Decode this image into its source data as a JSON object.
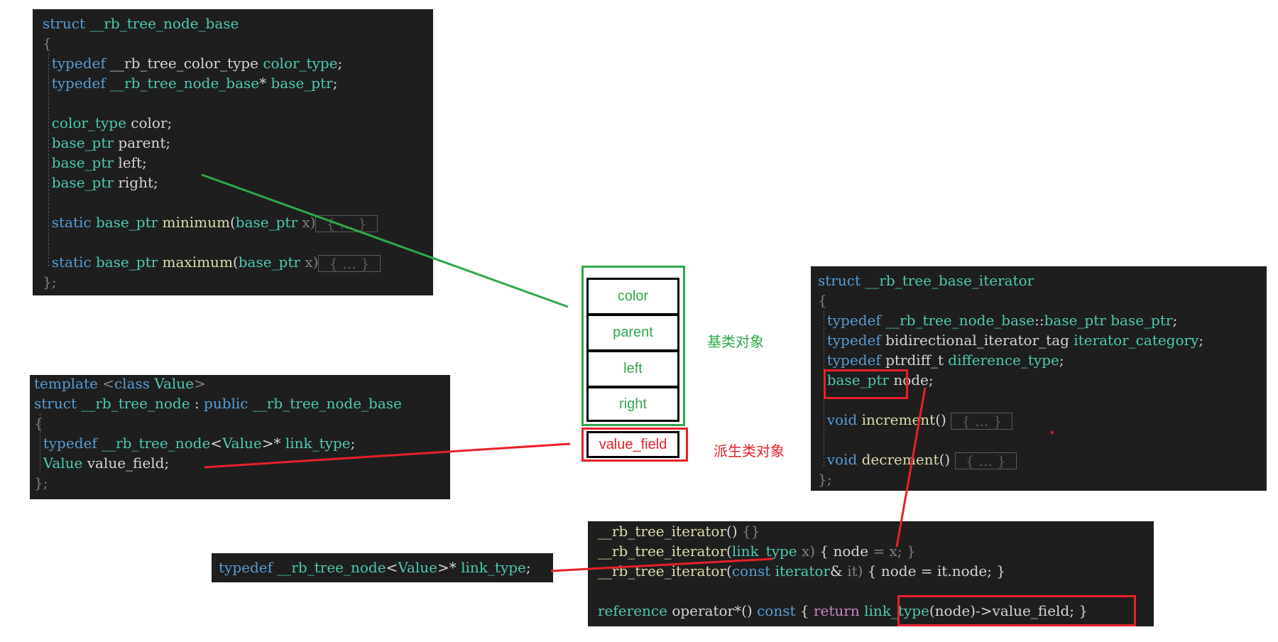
{
  "panel_node_base": {
    "lines": [
      [
        {
          "c": "k",
          "t": "struct "
        },
        {
          "c": "t",
          "t": "__rb_tree_node_base"
        }
      ],
      [
        {
          "c": "g",
          "t": "{"
        }
      ],
      [
        {
          "c": "k",
          "t": "  typedef "
        },
        {
          "c": "",
          "t": "__rb_tree_color_type "
        },
        {
          "c": "t",
          "t": "color_type"
        },
        {
          "c": "",
          "t": ";"
        }
      ],
      [
        {
          "c": "k",
          "t": "  typedef "
        },
        {
          "c": "t",
          "t": "__rb_tree_node_base"
        },
        {
          "c": "",
          "t": "* "
        },
        {
          "c": "t",
          "t": "base_ptr"
        },
        {
          "c": "",
          "t": ";"
        }
      ],
      [],
      [
        {
          "c": "t",
          "t": "  color_type "
        },
        {
          "c": "",
          "t": "color;"
        }
      ],
      [
        {
          "c": "t",
          "t": "  base_ptr "
        },
        {
          "c": "",
          "t": "parent;"
        }
      ],
      [
        {
          "c": "t",
          "t": "  base_ptr "
        },
        {
          "c": "",
          "t": "left;"
        }
      ],
      [
        {
          "c": "t",
          "t": "  base_ptr "
        },
        {
          "c": "",
          "t": "right;"
        }
      ],
      [],
      [
        {
          "c": "k",
          "t": "  static "
        },
        {
          "c": "t",
          "t": "base_ptr "
        },
        {
          "c": "f",
          "t": "minimum"
        },
        {
          "c": "",
          "t": "("
        },
        {
          "c": "t",
          "t": "base_ptr "
        },
        {
          "c": "g",
          "t": "x)"
        },
        {
          "c": "fold",
          "t": "{ ... }"
        }
      ],
      [],
      [
        {
          "c": "k",
          "t": "  static "
        },
        {
          "c": "t",
          "t": "base_ptr "
        },
        {
          "c": "f",
          "t": "maximum"
        },
        {
          "c": "",
          "t": "("
        },
        {
          "c": "t",
          "t": "base_ptr "
        },
        {
          "c": "g",
          "t": "x)"
        },
        {
          "c": "fold",
          "t": "{ ... }"
        }
      ],
      [
        {
          "c": "g",
          "t": "};"
        }
      ]
    ]
  },
  "panel_node": {
    "lines": [
      [
        {
          "c": "k",
          "t": "template "
        },
        {
          "c": "g",
          "t": "<"
        },
        {
          "c": "k",
          "t": "class "
        },
        {
          "c": "t",
          "t": "Value"
        },
        {
          "c": "g",
          "t": ">"
        }
      ],
      [
        {
          "c": "k",
          "t": "struct "
        },
        {
          "c": "t",
          "t": "__rb_tree_node "
        },
        {
          "c": "",
          "t": ": "
        },
        {
          "c": "k",
          "t": "public "
        },
        {
          "c": "t",
          "t": "__rb_tree_node_base"
        }
      ],
      [
        {
          "c": "g",
          "t": "{"
        }
      ],
      [
        {
          "c": "k",
          "t": "  typedef "
        },
        {
          "c": "t",
          "t": "__rb_tree_node"
        },
        {
          "c": "",
          "t": "<"
        },
        {
          "c": "t",
          "t": "Value"
        },
        {
          "c": "",
          "t": ">* "
        },
        {
          "c": "t",
          "t": "link_type"
        },
        {
          "c": "",
          "t": ";"
        }
      ],
      [
        {
          "c": "t",
          "t": "  Value "
        },
        {
          "c": "",
          "t": "value_field;"
        }
      ],
      [
        {
          "c": "g",
          "t": "};"
        }
      ]
    ]
  },
  "panel_link_type": {
    "lines": [
      [
        {
          "c": "k",
          "t": "typedef "
        },
        {
          "c": "t",
          "t": "__rb_tree_node"
        },
        {
          "c": "",
          "t": "<"
        },
        {
          "c": "t",
          "t": "Value"
        },
        {
          "c": "",
          "t": ">* "
        },
        {
          "c": "t",
          "t": "link_type"
        },
        {
          "c": "",
          "t": ";"
        }
      ]
    ]
  },
  "panel_iterator": {
    "lines": [
      [
        {
          "c": "f",
          "t": "__rb_tree_iterator"
        },
        {
          "c": "",
          "t": "() "
        },
        {
          "c": "g",
          "t": "{}"
        }
      ],
      [
        {
          "c": "f",
          "t": "__rb_tree_iterator"
        },
        {
          "c": "",
          "t": "("
        },
        {
          "c": "t",
          "t": "link_type "
        },
        {
          "c": "g",
          "t": "x) "
        },
        {
          "c": "",
          "t": "{ node "
        },
        {
          "c": "g",
          "t": "= x; }"
        }
      ],
      [
        {
          "c": "f",
          "t": "__rb_tree_iterator"
        },
        {
          "c": "",
          "t": "("
        },
        {
          "c": "k",
          "t": "const "
        },
        {
          "c": "t",
          "t": "iterator"
        },
        {
          "c": "",
          "t": "& "
        },
        {
          "c": "g",
          "t": "it) "
        },
        {
          "c": "",
          "t": "{ node = it.node; }"
        }
      ],
      [],
      [
        {
          "c": "t",
          "t": "reference "
        },
        {
          "c": "",
          "t": "operator*() "
        },
        {
          "c": "k",
          "t": "const "
        },
        {
          "c": "",
          "t": "{ "
        },
        {
          "c": "r",
          "t": "return "
        },
        {
          "c": "t",
          "t": "link_type"
        },
        {
          "c": "",
          "t": "(node)->value_field; }"
        }
      ]
    ]
  },
  "panel_base_iterator": {
    "lines": [
      [
        {
          "c": "k",
          "t": "struct "
        },
        {
          "c": "t",
          "t": "__rb_tree_base_iterator"
        }
      ],
      [
        {
          "c": "g",
          "t": "{"
        }
      ],
      [
        {
          "c": "k",
          "t": "  typedef "
        },
        {
          "c": "t",
          "t": "__rb_tree_node_base"
        },
        {
          "c": "",
          "t": "::"
        },
        {
          "c": "t",
          "t": "base_ptr "
        },
        {
          "c": "t",
          "t": "base_ptr"
        },
        {
          "c": "",
          "t": ";"
        }
      ],
      [
        {
          "c": "k",
          "t": "  typedef "
        },
        {
          "c": "",
          "t": "bidirectional_iterator_tag "
        },
        {
          "c": "t",
          "t": "iterator_category"
        },
        {
          "c": "",
          "t": ";"
        }
      ],
      [
        {
          "c": "k",
          "t": "  typedef "
        },
        {
          "c": "",
          "t": "ptrdiff_t "
        },
        {
          "c": "t",
          "t": "difference_type"
        },
        {
          "c": "",
          "t": ";"
        }
      ],
      [
        {
          "c": "t",
          "t": "  base_ptr "
        },
        {
          "c": "",
          "t": "node;"
        }
      ],
      [],
      [
        {
          "c": "k",
          "t": "  void "
        },
        {
          "c": "f",
          "t": "increment"
        },
        {
          "c": "",
          "t": "() "
        },
        {
          "c": "fold",
          "t": "{ ... }"
        }
      ],
      [],
      [
        {
          "c": "k",
          "t": "  void "
        },
        {
          "c": "f",
          "t": "decrement"
        },
        {
          "c": "",
          "t": "() "
        },
        {
          "c": "fold",
          "t": "{ ... }"
        }
      ],
      [
        {
          "c": "g",
          "t": "};"
        }
      ]
    ]
  },
  "memory_layout": {
    "cells": [
      "color",
      "parent",
      "left",
      "right"
    ],
    "derived_cell": "value_field",
    "base_label": "基类对象",
    "derived_label": "派生类对象"
  },
  "colors": {
    "base": "#2ea84a",
    "derived": "#e8202a",
    "code_bg": "#1e1e1e"
  }
}
